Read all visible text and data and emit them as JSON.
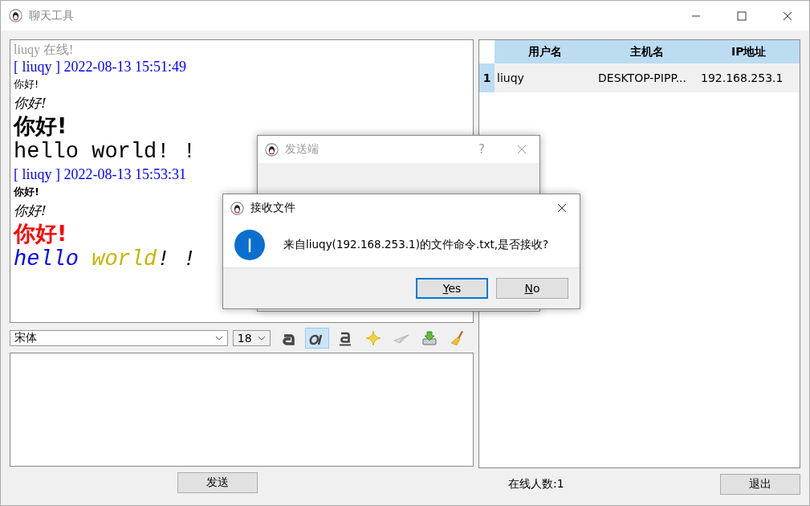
{
  "window": {
    "title": "聊天工具"
  },
  "messages": [
    {
      "kind": "status",
      "text": "liuqy 在线!"
    },
    {
      "kind": "header",
      "text": "[ liuqy ] 2022-08-13 15:51:49"
    },
    {
      "kind": "plain",
      "segments": [
        {
          "text": "你好!",
          "color": "#000000"
        }
      ]
    },
    {
      "kind": "brush",
      "segments": [
        {
          "text": "你好!",
          "color": "#000000"
        }
      ]
    },
    {
      "kind": "heavy",
      "segments": [
        {
          "text": "你好!",
          "color": "#000000"
        }
      ]
    },
    {
      "kind": "mono",
      "segments": [
        {
          "text": "hello world! !",
          "color": "#000000"
        }
      ]
    },
    {
      "kind": "header",
      "text": "[ liuqy ] 2022-08-13 15:53:31"
    },
    {
      "kind": "plain-bold",
      "segments": [
        {
          "text": "你好!",
          "color": "#000000"
        }
      ]
    },
    {
      "kind": "brush",
      "segments": [
        {
          "text": "你好!",
          "color": "#000000"
        }
      ]
    },
    {
      "kind": "heavy",
      "segments": [
        {
          "text": "你好!",
          "color": "#ff0000"
        }
      ]
    },
    {
      "kind": "mono-italic",
      "segments": [
        {
          "text": "hello ",
          "color": "#0000ff"
        },
        {
          "text": "world",
          "color": "#c8b400"
        },
        {
          "text": "! !",
          "color": "#000000"
        }
      ]
    }
  ],
  "toolbar": {
    "font": "宋体",
    "size": "18",
    "tools": [
      {
        "kind": "bold",
        "selected": false
      },
      {
        "kind": "italic",
        "selected": true
      },
      {
        "kind": "underline",
        "selected": false
      },
      {
        "kind": "color",
        "selected": false
      },
      {
        "kind": "send-file",
        "selected": false
      },
      {
        "kind": "save",
        "selected": false
      },
      {
        "kind": "clear",
        "selected": false
      }
    ]
  },
  "send_button": "发送",
  "online_count": "在线人数:1",
  "exit_button": "退出",
  "table": {
    "columns": [
      "用户名",
      "主机名",
      "IP地址"
    ],
    "rows": [
      {
        "number": "1",
        "selected": true,
        "cells": [
          "liuqy",
          "DESKTOP-PIPP...",
          "192.168.253.1"
        ]
      }
    ]
  },
  "sender_dialog": {
    "title": "发送端",
    "help": "?"
  },
  "receive_dialog": {
    "title": "接收文件",
    "message": "来自liuqy(192.168.253.1)的文件命令.txt,是否接收?",
    "buttons": [
      {
        "label": "Yes",
        "default": true
      },
      {
        "label": "No",
        "default": false
      }
    ]
  }
}
